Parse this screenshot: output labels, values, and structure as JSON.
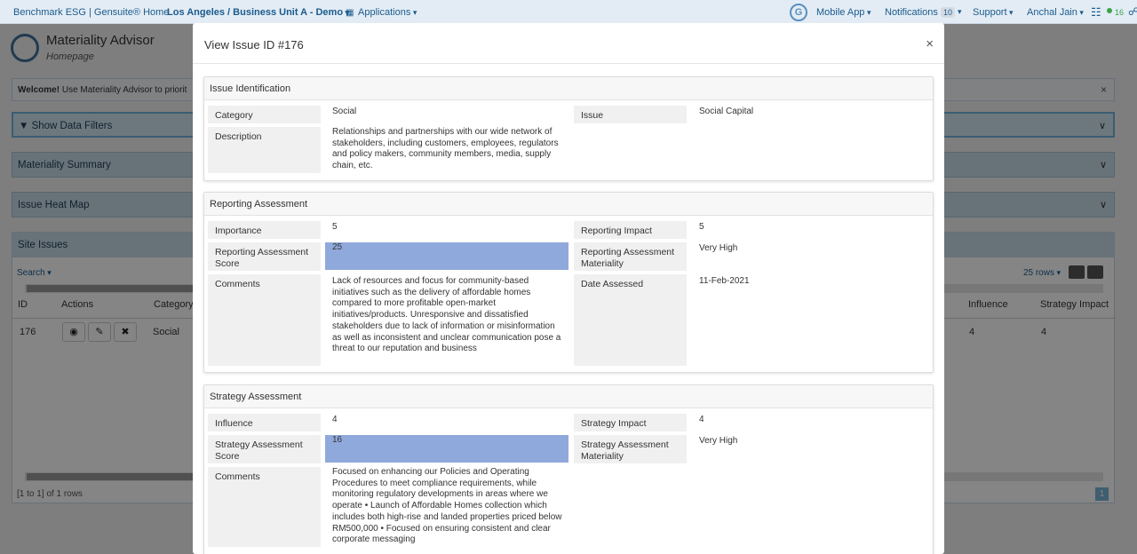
{
  "topbar": {
    "brand": "Benchmark ESG | Gensuite® Home",
    "location": "Los Angeles / Business Unit A - Demo",
    "applications": "Applications",
    "mobile_app": "Mobile App",
    "notifications": "Notifications",
    "notif_count": "10",
    "support": "Support",
    "user": "Anchal Jain",
    "online_count": "16"
  },
  "app": {
    "title": "Materiality Advisor",
    "subtitle": "Homepage"
  },
  "welcome": {
    "bold": "Welcome!",
    "text": "Use Materiality Advisor to priorit"
  },
  "accordions": {
    "filters": "Show Data Filters",
    "summary": "Materiality Summary",
    "heatmap": "Issue Heat Map",
    "site_issues": "Site Issues"
  },
  "table": {
    "search": "Search",
    "rows": "25 rows",
    "columns": {
      "id": "ID",
      "actions": "Actions",
      "category": "Category",
      "influence": "Influence",
      "strategy_impact": "Strategy Impact"
    },
    "row": {
      "id": "176",
      "category": "Social",
      "influence": "4",
      "strategy_impact": "4"
    },
    "footer": "[1 to 1] of 1 rows",
    "page": "1"
  },
  "modal": {
    "title": "View Issue ID #176",
    "identification": {
      "heading": "Issue Identification",
      "category_label": "Category",
      "category": "Social",
      "issue_label": "Issue",
      "issue": "Social Capital",
      "description_label": "Description",
      "description": "Relationships and partnerships with our wide network of stakeholders, including customers, employees, regulators and policy makers, community members, media, supply chain, etc."
    },
    "reporting": {
      "heading": "Reporting Assessment",
      "importance_label": "Importance",
      "importance": "5",
      "impact_label": "Reporting Impact",
      "impact": "5",
      "score_label": "Reporting Assessment Score",
      "score": "25",
      "materiality_label": "Reporting Assessment Materiality",
      "materiality": "Very High",
      "comments_label": "Comments",
      "comments": "Lack of resources and focus for community-based initiatives such as the delivery of affordable homes compared to more profitable open-market initiatives/products. Unresponsive and dissatisfied stakeholders due to lack of information or misinformation as well as inconsistent and unclear communication pose a threat to our reputation and business",
      "date_label": "Date Assessed",
      "date": "11-Feb-2021"
    },
    "strategy": {
      "heading": "Strategy Assessment",
      "influence_label": "Influence",
      "influence": "4",
      "impact_label": "Strategy Impact",
      "impact": "4",
      "score_label": "Strategy Assessment Score",
      "score": "16",
      "materiality_label": "Strategy Assessment Materiality",
      "materiality": "Very High",
      "comments_label": "Comments",
      "comments": "Focused on enhancing our Policies and Operating Procedures to meet compliance requirements, while monitoring regulatory developments in areas where we operate • Launch of Affordable Homes collection which includes both high-rise and landed properties priced below RM500,000 • Focused on ensuring consistent and clear corporate messaging"
    }
  }
}
